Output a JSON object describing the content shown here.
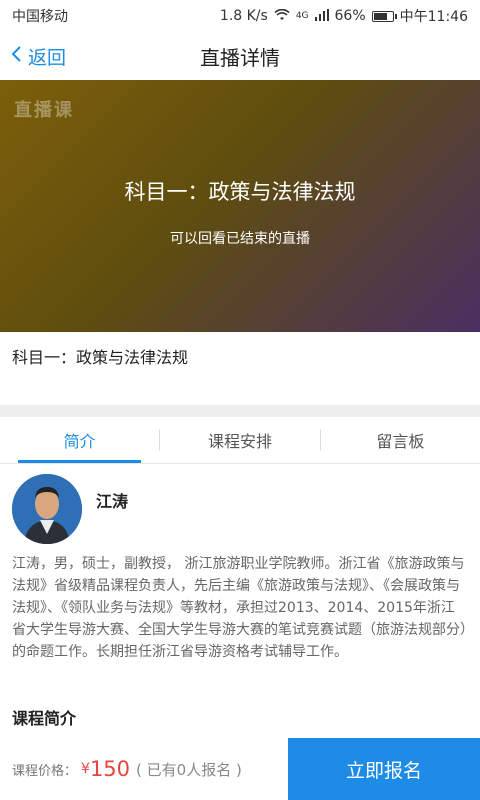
{
  "status_bar": {
    "carrier": "中国移动",
    "speed": "1.8 K/s",
    "network": "4G",
    "battery": "66%",
    "time": "中午11:46"
  },
  "nav": {
    "back_label": "返回",
    "title": "直播详情"
  },
  "video": {
    "watermark": "直播课",
    "title": "科目一：政策与法律法规",
    "subtitle": "可以回看已结束的直播"
  },
  "course": {
    "name": "科目一：政策与法律法规"
  },
  "tabs": [
    {
      "label": "简介"
    },
    {
      "label": "课程安排"
    },
    {
      "label": "留言板"
    }
  ],
  "teacher": {
    "name": "江涛",
    "bio": "江涛，男，硕士，副教授， 浙江旅游职业学院教师。浙江省《旅游政策与法规》省级精品课程负责人，先后主编《旅游政策与法规》、《会展政策与法规》、《领队业务与法规》等教材，承担过2013、2014、2015年浙江省大学生导游大赛、全国大学生导游大赛的笔试竞赛试题（旅游法规部分）的命题工作。长期担任浙江省导游资格考试辅导工作。"
  },
  "section": {
    "course_intro_title": "课程简介"
  },
  "bottom": {
    "price_label": "课程价格：",
    "currency": "¥",
    "price": "150",
    "enrolled": "( 已有0人报名 )",
    "signup_label": "立即报名"
  },
  "colors": {
    "accent": "#1e8ce6",
    "price": "#e8453c"
  }
}
